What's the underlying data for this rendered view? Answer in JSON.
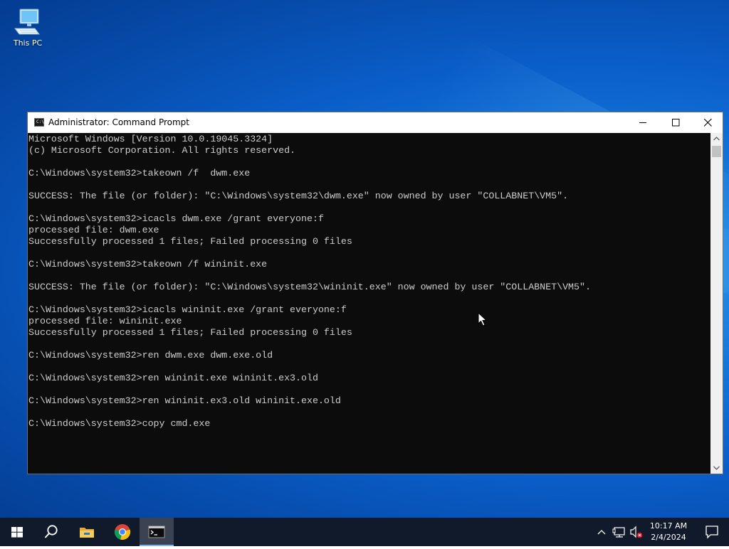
{
  "desktop": {
    "icons": [
      {
        "label": "This PC",
        "icon": "computer-icon"
      }
    ]
  },
  "window": {
    "title": "Administrator: Command Prompt",
    "icon": "cmd-icon",
    "icon_text": "C:\\"
  },
  "terminal": {
    "lines": [
      "Microsoft Windows [Version 10.0.19045.3324]",
      "(c) Microsoft Corporation. All rights reserved.",
      "",
      "C:\\Windows\\system32>takeown /f  dwm.exe",
      "",
      "SUCCESS: The file (or folder): \"C:\\Windows\\system32\\dwm.exe\" now owned by user \"COLLABNET\\VM5\".",
      "",
      "C:\\Windows\\system32>icacls dwm.exe /grant everyone:f",
      "processed file: dwm.exe",
      "Successfully processed 1 files; Failed processing 0 files",
      "",
      "C:\\Windows\\system32>takeown /f wininit.exe",
      "",
      "SUCCESS: The file (or folder): \"C:\\Windows\\system32\\wininit.exe\" now owned by user \"COLLABNET\\VM5\".",
      "",
      "C:\\Windows\\system32>icacls wininit.exe /grant everyone:f",
      "processed file: wininit.exe",
      "Successfully processed 1 files; Failed processing 0 files",
      "",
      "C:\\Windows\\system32>ren dwm.exe dwm.exe.old",
      "",
      "C:\\Windows\\system32>ren wininit.exe wininit.ex3.old",
      "",
      "C:\\Windows\\system32>ren wininit.ex3.old wininit.exe.old",
      "",
      "C:\\Windows\\system32>copy cmd.exe"
    ]
  },
  "taskbar": {
    "items": [
      {
        "name": "start",
        "icon": "windows-logo-icon"
      },
      {
        "name": "search",
        "icon": "search-icon"
      },
      {
        "name": "file-explorer",
        "icon": "folder-icon"
      },
      {
        "name": "chrome",
        "icon": "chrome-icon"
      },
      {
        "name": "command-prompt",
        "icon": "cmd-icon",
        "active": true
      }
    ],
    "tray": {
      "icons": [
        "chevron-up-icon",
        "network-icon",
        "volume-muted-icon"
      ],
      "time": "10:17 AM",
      "date": "2/4/2024",
      "notification_icon": "notification-icon"
    }
  },
  "colors": {
    "terminal_bg": "#0c0c0c",
    "terminal_fg": "#cccccc",
    "taskbar_bg": "#101a2a",
    "desktop_accent": "#0a5dc8"
  }
}
